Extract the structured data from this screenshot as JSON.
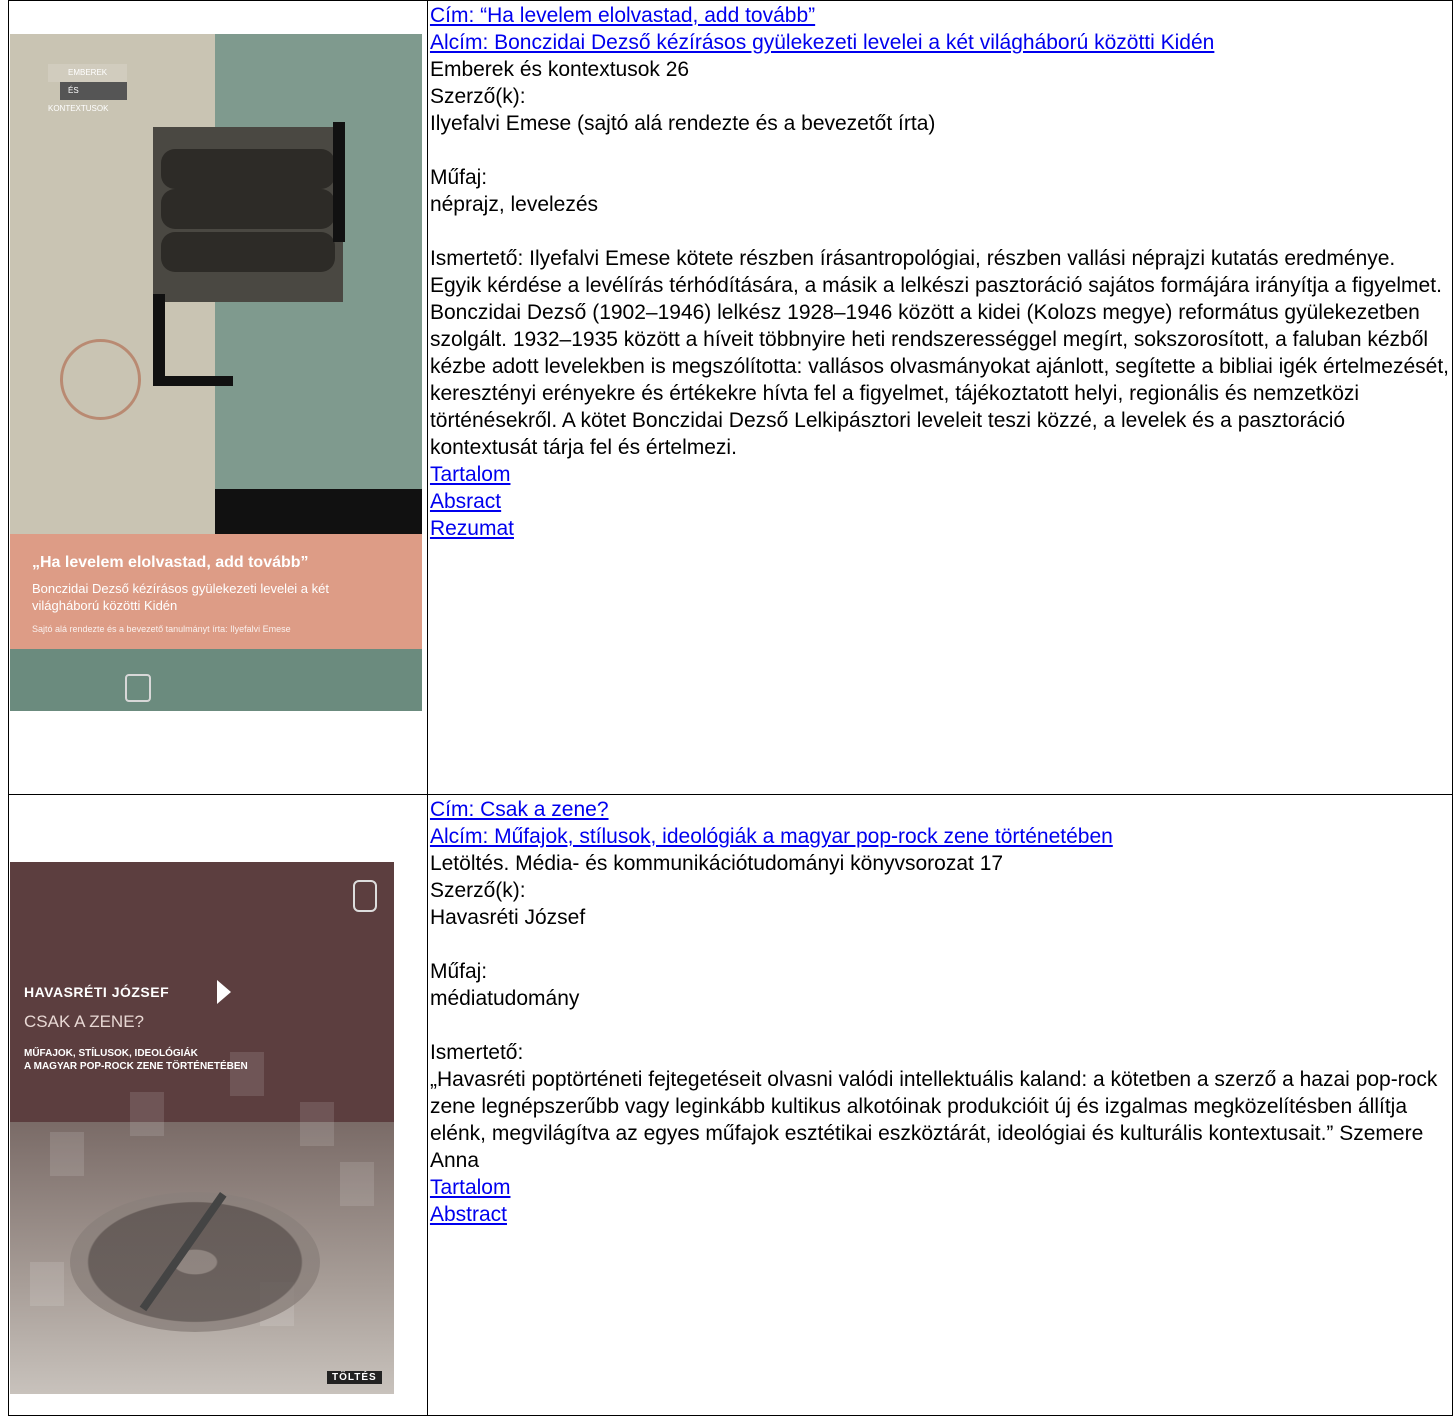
{
  "books": [
    {
      "title": "Cím: “Ha levelem elolvastad, add tovább”",
      "subtitle": "Alcím: Bonczidai Dezső kézírásos gyülekezeti levelei a két világháború közötti Kidén",
      "series": "Emberek és kontextusok 26",
      "authors_label": "Szerző(k):",
      "authors": "Ilyefalvi Emese (sajtó alá rendezte és a bevezetőt írta)",
      "genre_label": "Műfaj:",
      "genre": "néprajz, levelezés",
      "description": "Ismertető: Ilyefalvi Emese kötete részben írásantropológiai, részben vallási néprajzi kutatás eredménye. Egyik kérdése a levélírás térhódítására, a másik a lelkészi pasztoráció sajátos formájára irányítja a figyelmet. Bonczidai Dezső (1902–1946) lelkész 1928–1946 között a kidei (Kolozs megye) református gyülekezetben szolgált. 1932–1935 között a híveit többnyire heti rendszerességgel megírt, sokszorosított, a faluban kézből kézbe adott levelekben is megszólította: vallásos olvasmányokat ajánlott, segítette a bibliai igék értelmezését, keresztényi erényekre és értékekre hívta fel a figyelmet, tájékoztatott helyi, regionális és nemzetközi történésekről. A kötet Bonczidai Dezső Lelkipásztori leveleit teszi közzé, a levelek és a pasztoráció kontextusát tárja fel és értelmezi.",
      "links": [
        "Tartalom",
        "Absract",
        "Rezumat"
      ],
      "cover": {
        "series_line1": "EMBEREK",
        "series_line2": "ÉS",
        "series_line3": "KONTEXTUSOK",
        "title": "„Ha levelem elolvastad, add tovább”",
        "subtitle": "Bonczidai Dezső kézírásos gyülekezeti levelei a két világháború közötti Kidén",
        "editor": "Sajtó alá rendezte és a bevezető tanulmányt írta: Ilyefalvi Emese"
      }
    },
    {
      "title": "Cím: Csak a zene?",
      "subtitle": "Alcím: Műfajok, stílusok, ideológiák a magyar pop-rock zene történetében",
      "series": "Letöltés. Média- és kommunikációtudományi könyvsorozat 17",
      "authors_label": "Szerző(k):",
      "authors": "Havasréti József",
      "genre_label": "Műfaj:",
      "genre": "médiatudomány",
      "description_label": "Ismertető:",
      "description": "„Havasréti poptörténeti fejtegetéseit olvasni valódi intellektuális kaland: a kötetben a szerző a hazai pop-rock zene legnépszerűbb vagy leginkább kultikus alkotóinak produkcióit új és izgalmas megközelítésben állítja elénk, megvilágítva az egyes műfajok esztétikai eszköztárát, ideológiai és kulturális kontextusait.” Szemere Anna",
      "links": [
        "Tartalom",
        "Abstract"
      ],
      "cover": {
        "author": "HAVASRÉTI JÓZSEF",
        "title": "CSAK A ZENE?",
        "subtitle_line1": "MŰFAJOK, STÍLUSOK, IDEOLÓGIÁK",
        "subtitle_line2": "A MAGYAR POP-ROCK ZENE TÖRTÉNETÉBEN",
        "publisher": "TÖLTÉS"
      }
    }
  ]
}
